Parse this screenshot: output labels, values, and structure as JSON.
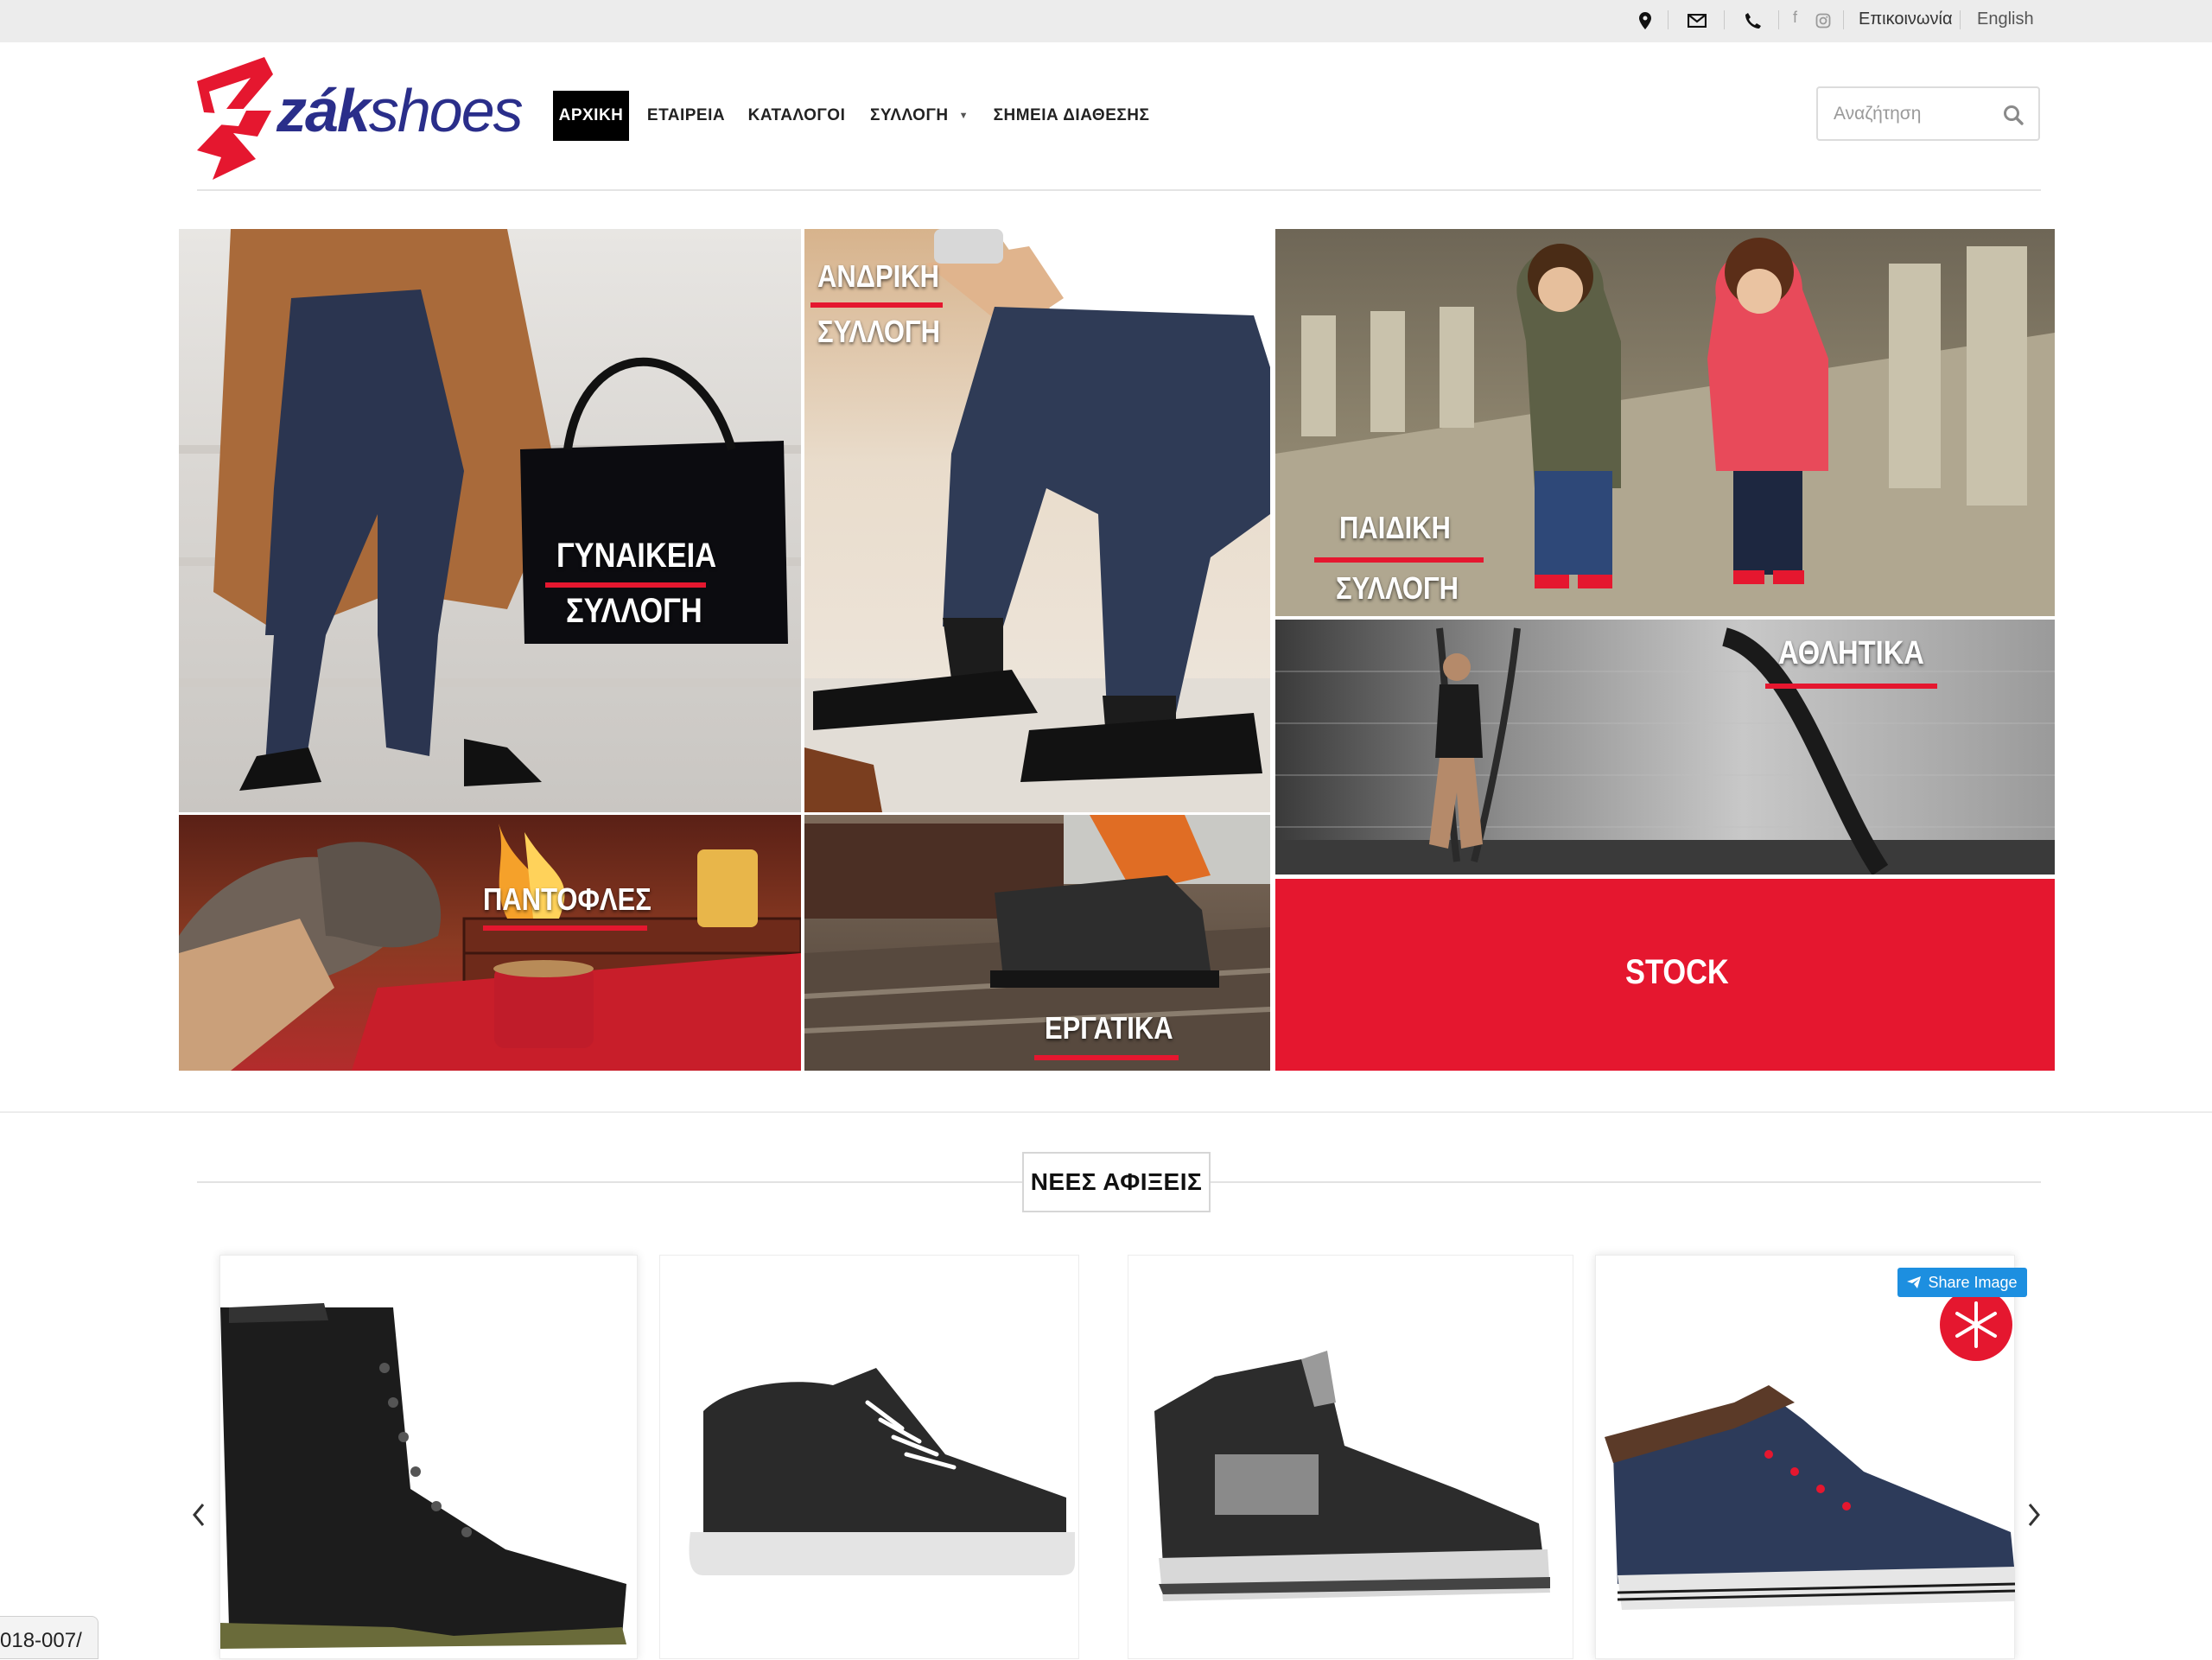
{
  "topbar": {
    "contact_label": "Επικοινωνία",
    "language_label": "English",
    "icons": [
      "location-pin-icon",
      "envelope-icon",
      "phone-icon",
      "facebook-icon",
      "instagram-icon"
    ],
    "facebook_glyph": "f"
  },
  "header": {
    "logo_text_bold": "zák",
    "logo_text_light": "shoes",
    "nav": [
      {
        "label": "ΑΡΧΙΚΗ",
        "active": true
      },
      {
        "label": "ΕΤΑΙΡΕΙΑ"
      },
      {
        "label": "ΚΑΤΑΛΟΓΟΙ"
      },
      {
        "label": "ΣΥΛΛΟΓΗ",
        "has_dropdown": true
      },
      {
        "label": "ΣΗΜΕΙΑ ΔΙΑΘΕΣΗΣ"
      }
    ],
    "search_placeholder": "Αναζήτηση"
  },
  "categories": {
    "women_line1": "ΓΥΝΑΙΚΕΙΑ",
    "women_line2": "ΣΥΛΛΟΓΗ",
    "men_line1": "ΑΝΔΡΙΚΗ",
    "men_line2": "ΣΥΛΛΟΓΗ",
    "kids_line1": "ΠΑΙΔΙΚΗ",
    "kids_line2": "ΣΥΛΛΟΓΗ",
    "sports": "ΑΘΛΗΤΙΚΑ",
    "slippers": "ΠΑΝΤΟΦΛΕΣ",
    "work": "ΕΡΓΑΤΙΚΑ",
    "stock": "STOCK"
  },
  "arrivals": {
    "title": "ΝΕΕΣ ΑΦΙΞΕΙΣ",
    "share_label": "Share Image",
    "products": [
      {
        "name": "black-combat-boot"
      },
      {
        "name": "black-platform-sneaker"
      },
      {
        "name": "black-high-top-sneaker"
      },
      {
        "name": "navy-high-top-sneaker"
      }
    ]
  },
  "status_url": "018-007/",
  "colors": {
    "brand_red": "#e5172f",
    "brand_navy": "#2a2e8a",
    "share_blue": "#1d8fe0"
  }
}
